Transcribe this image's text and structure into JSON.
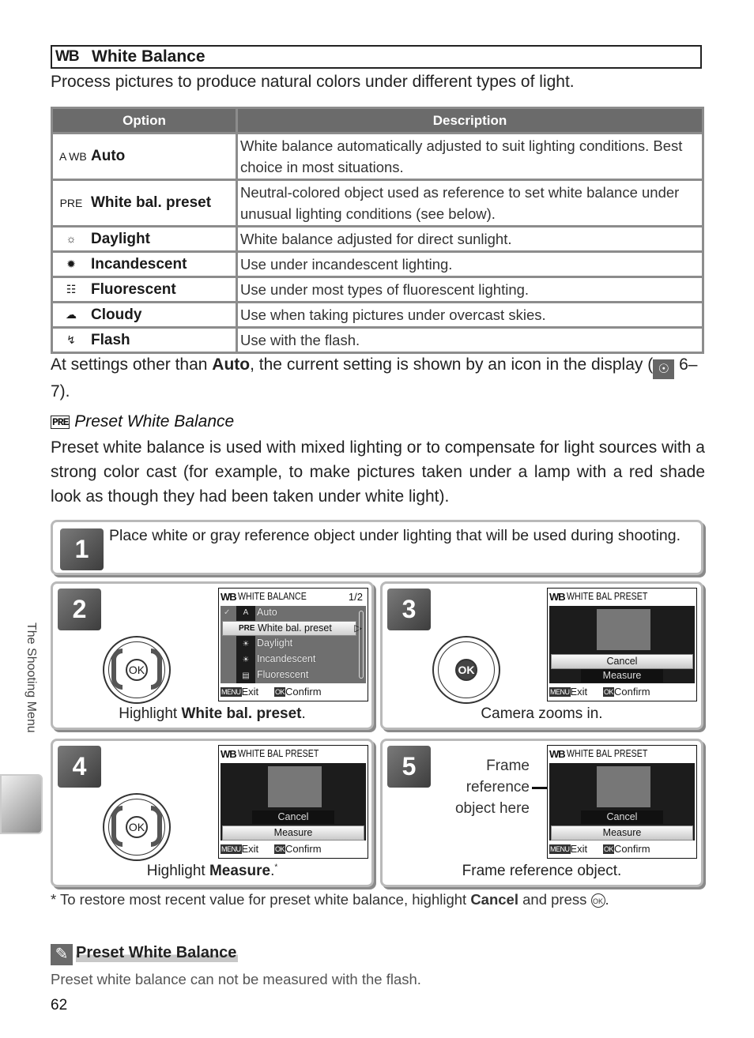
{
  "section": {
    "icon": "WB",
    "title": "White Balance",
    "intro": "Process pictures to produce natural colors under different types of light."
  },
  "table": {
    "headers": {
      "option": "Option",
      "description": "Description"
    },
    "rows": [
      {
        "icon": "auto-wb-icon",
        "glyph": "A WB",
        "option": "Auto",
        "description": "White balance automatically adjusted to suit lighting conditions. Best choice in most situations."
      },
      {
        "icon": "preset-icon",
        "glyph": "PRE",
        "option": "White bal. preset",
        "description": "Neutral-colored object used as reference to set white balance under unusual lighting conditions (see below)."
      },
      {
        "icon": "daylight-icon",
        "glyph": "☼",
        "option": "Daylight",
        "description": "White balance adjusted for direct sunlight."
      },
      {
        "icon": "incandescent-icon",
        "glyph": "✹",
        "option": "Incandescent",
        "description": "Use under incandescent lighting."
      },
      {
        "icon": "fluorescent-icon",
        "glyph": "☷",
        "option": "Fluorescent",
        "description": "Use under most types of fluorescent lighting."
      },
      {
        "icon": "cloudy-icon",
        "glyph": "☁",
        "option": "Cloudy",
        "description": "Use when taking pictures under overcast skies."
      },
      {
        "icon": "flash-icon",
        "glyph": "↯",
        "option": "Flash",
        "description": "Use with the flash."
      }
    ]
  },
  "para1": {
    "before": "At settings other than ",
    "bold": "Auto",
    "after": ", the current setting is shown by an icon in the display (",
    "ref_icon": "☉",
    "ref": " 6–7)."
  },
  "preset_section": {
    "icon": "PRE",
    "heading": "Preset White Balance",
    "body": "Preset white balance is used with mixed lighting or to compensate for light sources with a strong color cast (for example, to make pictures taken under a lamp with a red shade look as though they had been taken under white light)."
  },
  "steps": [
    {
      "num": "1",
      "text": "Place white or gray reference object under lighting that will be used during shooting."
    },
    {
      "num": "2",
      "caption_before": "Highlight ",
      "caption_bold": "White bal. preset",
      "caption_after": "."
    },
    {
      "num": "3",
      "caption": "Camera zooms in."
    },
    {
      "num": "4",
      "caption_before": "Highlight ",
      "caption_bold": "Measure",
      "caption_after": ".",
      "caption_sup": "*"
    },
    {
      "num": "5",
      "caption": "Frame reference object.",
      "callout": "Frame reference object here"
    }
  ],
  "lcd_menu": {
    "title": "WHITE BALANCE",
    "page": "1/2",
    "items": [
      "Auto",
      "White bal. preset",
      "Daylight",
      "Incandescent",
      "Fluorescent"
    ],
    "selected": "White bal. preset",
    "exit_key": "MENU",
    "exit": "Exit",
    "confirm_key": "OK",
    "confirm": "Confirm"
  },
  "lcd_preset": {
    "title": "WHITE BAL PRESET",
    "cancel": "Cancel",
    "measure": "Measure",
    "exit_key": "MENU",
    "exit": "Exit",
    "confirm_key": "OK",
    "confirm": "Confirm"
  },
  "dial_ok": "OK",
  "footnote": {
    "before": "*  To restore most recent value for preset white balance, highlight ",
    "bold": "Cancel",
    "after": " and press ",
    "key": "OK",
    "end": "."
  },
  "note": {
    "heading": "Preset White Balance",
    "body": "Preset white balance can not be measured with the flash."
  },
  "side_tab": "The Shooting Menu",
  "page_number": "62"
}
